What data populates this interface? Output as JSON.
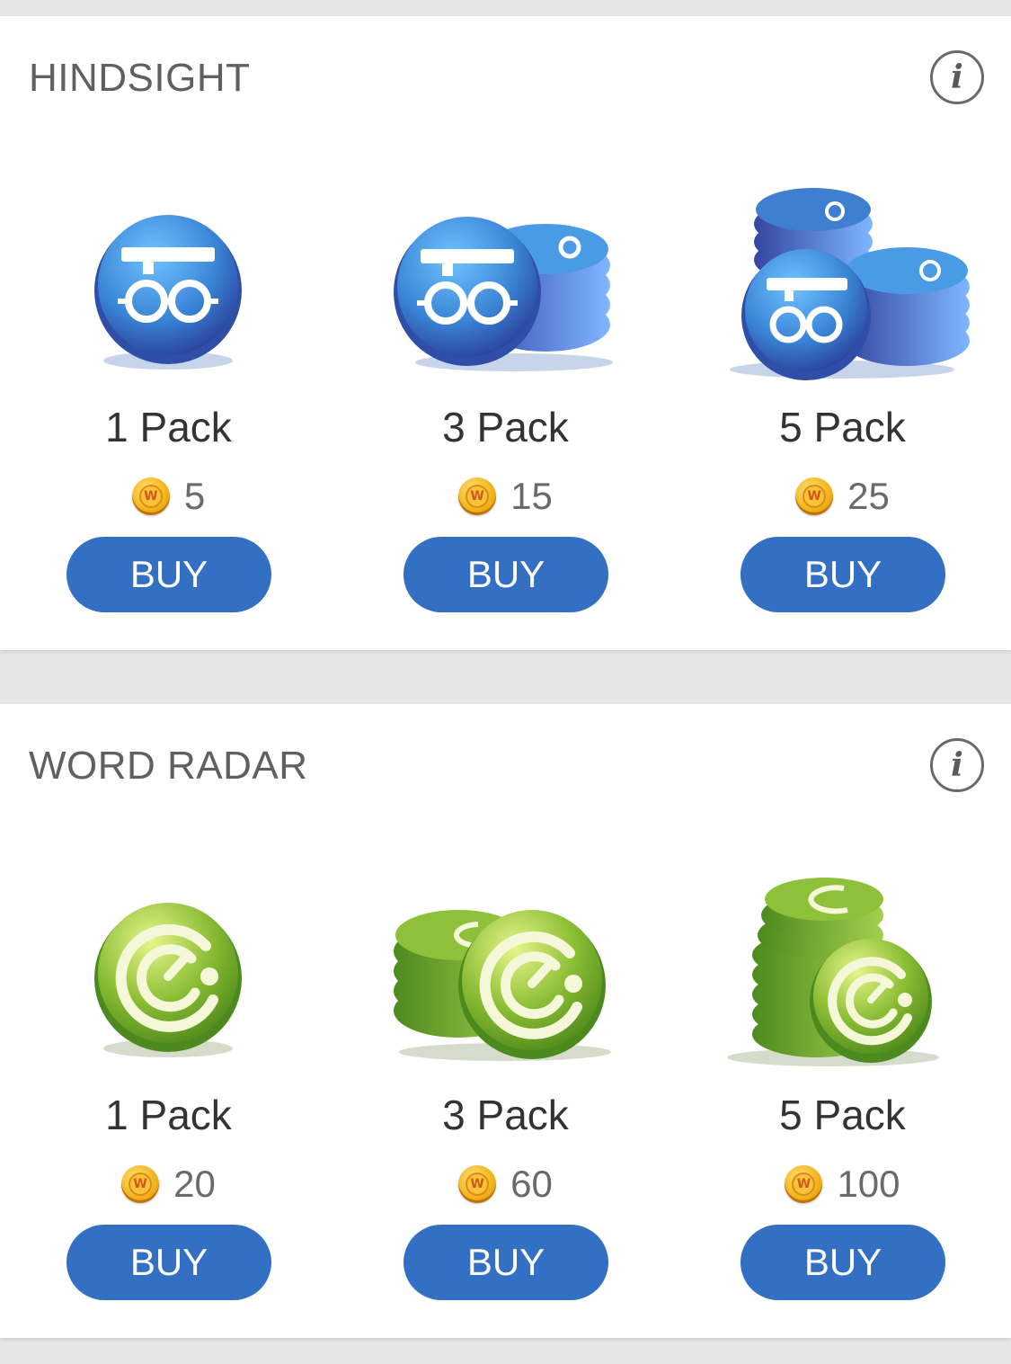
{
  "colors": {
    "page_background": "#e6e6e6",
    "card_background": "#ffffff",
    "buy_button": "#336fc2",
    "hindsight_token": "#3b8fd8",
    "radar_token": "#7fb02e",
    "coin_gold": "#f3b51c"
  },
  "sections": [
    {
      "title": "HINDSIGHT",
      "info_icon": "info-icon",
      "token_icon": "glasses-graduation-cap-icon",
      "items": [
        {
          "label": "1 Pack",
          "price": "5",
          "buy_label": "BUY",
          "stack": 1
        },
        {
          "label": "3 Pack",
          "price": "15",
          "buy_label": "BUY",
          "stack": 3
        },
        {
          "label": "5 Pack",
          "price": "25",
          "buy_label": "BUY",
          "stack": 5
        }
      ]
    },
    {
      "title": "WORD RADAR",
      "info_icon": "info-icon",
      "token_icon": "radar-icon",
      "items": [
        {
          "label": "1 Pack",
          "price": "20",
          "buy_label": "BUY",
          "stack": 1
        },
        {
          "label": "3 Pack",
          "price": "60",
          "buy_label": "BUY",
          "stack": 3
        },
        {
          "label": "5 Pack",
          "price": "100",
          "buy_label": "BUY",
          "stack": 5
        }
      ]
    }
  ],
  "coin_icon": {
    "name": "word-coin-icon",
    "glyph": "W"
  },
  "info_glyph": "i"
}
